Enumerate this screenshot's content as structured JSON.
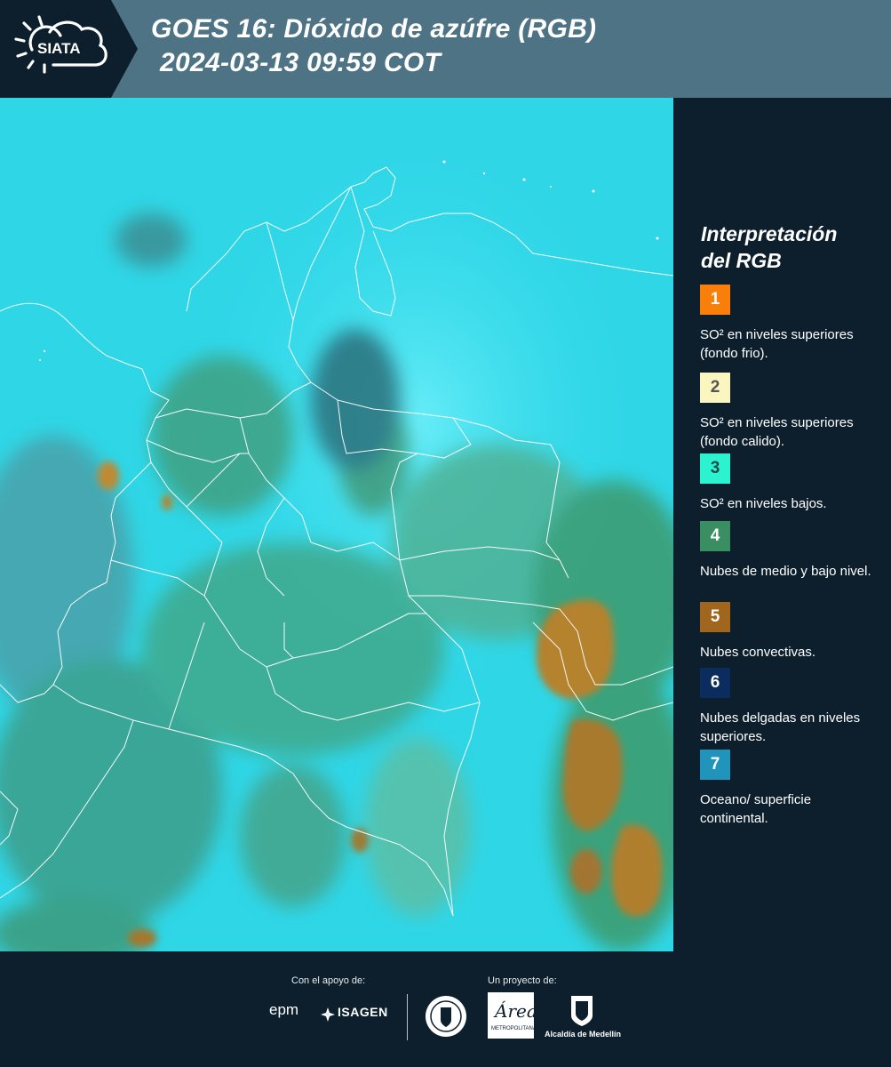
{
  "header": {
    "brand": "SIATA",
    "title_line1": "GOES 16: Dióxido de azúfre (RGB)",
    "title_line2": "2024-03-13 09:59 COT"
  },
  "legend": {
    "title_line1": "Interpretación",
    "title_line2": "del RGB",
    "items": [
      {
        "num": "1",
        "color": "#fa7f0a",
        "num_color": "#ffffff",
        "text": "SO² en niveles superiores (fondo frio)."
      },
      {
        "num": "2",
        "color": "#fbf5bf",
        "num_color": "#555555",
        "text": "SO² en niveles superiores (fondo calido)."
      },
      {
        "num": "3",
        "color": "#2bf2cf",
        "num_color": "#1d4c47",
        "text": "SO² en niveles bajos."
      },
      {
        "num": "4",
        "color": "#3a8f62",
        "num_color": "#ffffff",
        "text": "Nubes de medio y bajo nivel."
      },
      {
        "num": "5",
        "color": "#a0661e",
        "num_color": "#ffffff",
        "text": "Nubes convectivas."
      },
      {
        "num": "6",
        "color": "#0b2c5e",
        "num_color": "#ffffff",
        "text": "Nubes delgadas en niveles superiores."
      },
      {
        "num": "7",
        "color": "#2094bb",
        "num_color": "#ffffff",
        "text": "Oceano/ superficie continental."
      }
    ]
  },
  "footer": {
    "support_label": "Con el apoyo de:",
    "project_label": "Un proyecto de:",
    "sponsor1": "epm",
    "sponsor2": "ISAGEN",
    "org1": "Área Metropolitana",
    "org2": "Alcaldía de Medellín"
  },
  "colors": {
    "header_bg": "#4e7384",
    "dark_bg": "#0d1f2d",
    "cyan": "#2bd8ea",
    "green": "#3d9a5e",
    "brown": "#b07a2a"
  }
}
